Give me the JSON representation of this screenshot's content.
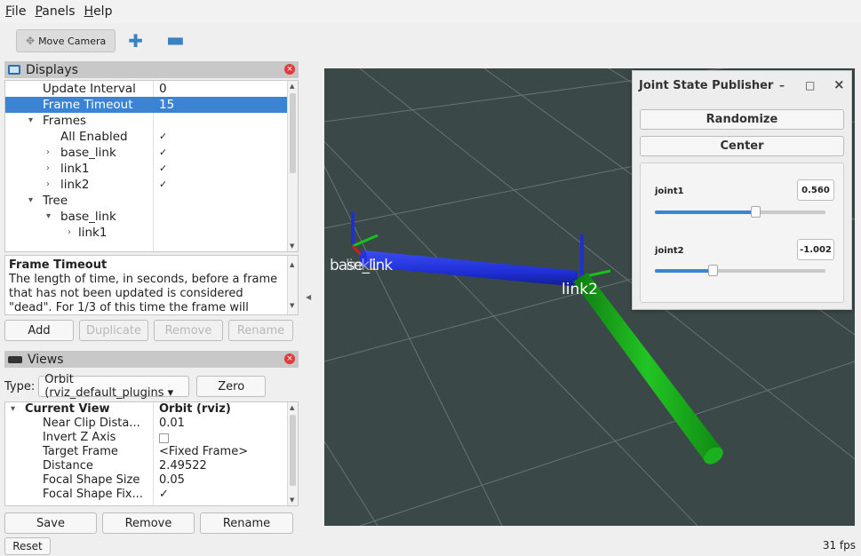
{
  "menu": [
    {
      "label": "File",
      "mnemonic": "F",
      "rest": "ile"
    },
    {
      "label": "Panels",
      "mnemonic": "P",
      "rest": "anels"
    },
    {
      "label": "Help",
      "mnemonic": "H",
      "rest": "elp"
    }
  ],
  "toolbar": {
    "move_camera": "Move Camera",
    "add_icon": "plus-icon",
    "remove_icon": "minus-icon"
  },
  "displays": {
    "title": "Displays",
    "rows": [
      {
        "name": "Update Interval",
        "value": "0"
      },
      {
        "name": "Frame Timeout",
        "value": "15"
      },
      {
        "name": "Frames",
        "value": ""
      },
      {
        "name": "All Enabled",
        "checked": true
      },
      {
        "name": "base_link",
        "checked": true
      },
      {
        "name": "link1",
        "checked": true
      },
      {
        "name": "link2",
        "checked": true
      },
      {
        "name": "Tree",
        "value": ""
      },
      {
        "name": "base_link",
        "value": ""
      },
      {
        "name": "link1",
        "value": ""
      }
    ],
    "check_mark": "✓",
    "description_title": "Frame Timeout",
    "description_text": "The length of time, in seconds, before a frame that has not been updated is considered \"dead\". For 1/3 of this time the frame will",
    "buttons": {
      "add": "Add",
      "duplicate": "Duplicate",
      "remove": "Remove",
      "rename": "Rename"
    }
  },
  "views": {
    "title": "Views",
    "type_label": "Type:",
    "type_value": "Orbit (rviz_default_plugins ▾",
    "zero": "Zero",
    "rows": [
      {
        "name": "Current View",
        "value": "Orbit (rviz)"
      },
      {
        "name": "Near Clip Dista...",
        "value": "0.01"
      },
      {
        "name": "Invert Z Axis",
        "value": ""
      },
      {
        "name": "Target Frame",
        "value": "<Fixed Frame>"
      },
      {
        "name": "Distance",
        "value": "2.49522"
      },
      {
        "name": "Focal Shape Size",
        "value": "0.05"
      },
      {
        "name": "Focal Shape Fix...",
        "value": "✓"
      }
    ],
    "buttons": {
      "save": "Save",
      "remove": "Remove",
      "rename": "Rename"
    }
  },
  "viewport": {
    "label_base": "base_link",
    "label_link1": "link1",
    "label_link2": "link2"
  },
  "joint_state_publisher": {
    "title": "Joint State Publisher",
    "minimize": "–",
    "maximize": "□",
    "close": "×",
    "randomize": "Randomize",
    "center": "Center",
    "joints": [
      {
        "name": "joint1",
        "value": "0.560",
        "fraction": 0.59
      },
      {
        "name": "joint2",
        "value": "-1.002",
        "fraction": 0.34
      }
    ]
  },
  "status": {
    "reset": "Reset",
    "fps": "31 fps"
  },
  "colors": {
    "selection": "#3a84d3",
    "viewport_bg": "#3a4847",
    "link1": "#1f2fd6",
    "link2": "#16a81a"
  }
}
